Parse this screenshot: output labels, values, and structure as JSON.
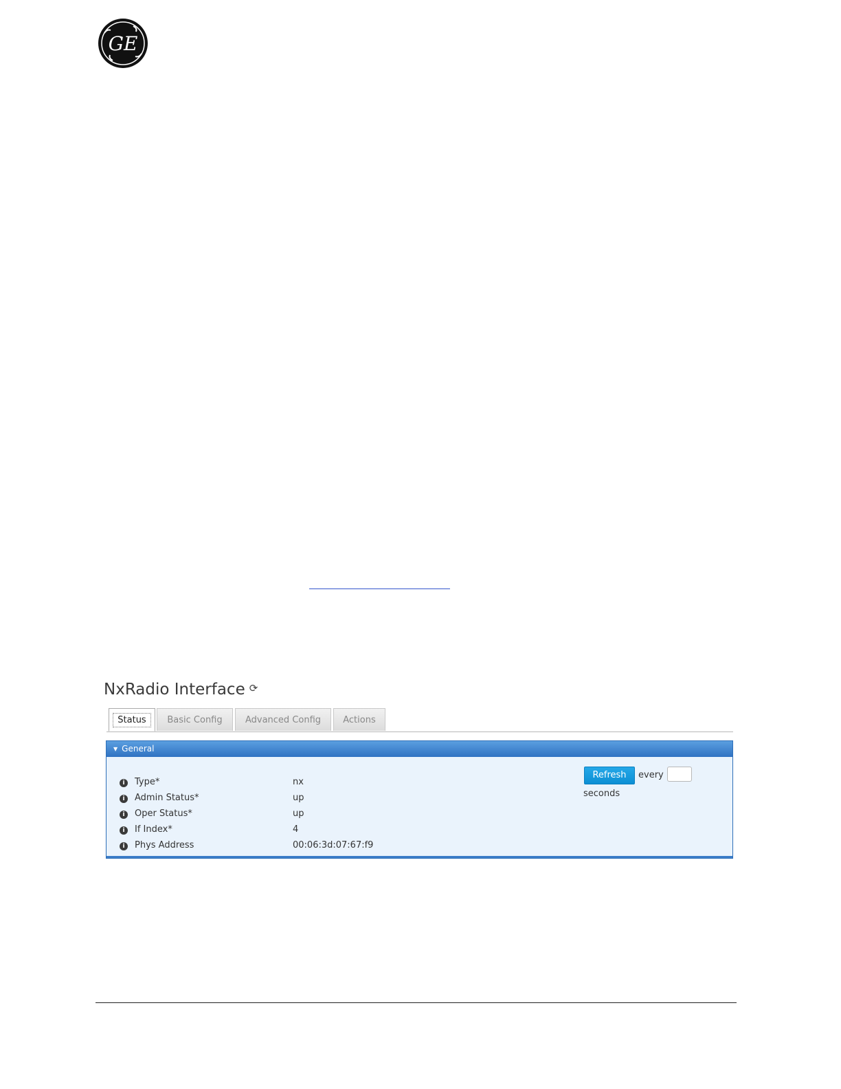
{
  "logo": {
    "text": "GE"
  },
  "panel": {
    "title": "NxRadio Interface",
    "tabs": [
      {
        "label": "Status"
      },
      {
        "label": "Basic Config"
      },
      {
        "label": "Advanced Config"
      },
      {
        "label": "Actions"
      }
    ],
    "section": {
      "title": "General",
      "fields": [
        {
          "label": "Type*",
          "value": "nx"
        },
        {
          "label": "Admin Status*",
          "value": "up"
        },
        {
          "label": "Oper Status*",
          "value": "up"
        },
        {
          "label": "If Index*",
          "value": "4"
        },
        {
          "label": "Phys Address",
          "value": "00:06:3d:07:67:f9"
        }
      ],
      "refresh": {
        "button_label": "Refresh",
        "every_label": "every",
        "interval_value": "",
        "seconds_label": "seconds"
      }
    }
  },
  "colors": {
    "header_blue": "#2f72c2",
    "button_blue": "#1a9ede",
    "section_bg": "#eaf3fc"
  }
}
